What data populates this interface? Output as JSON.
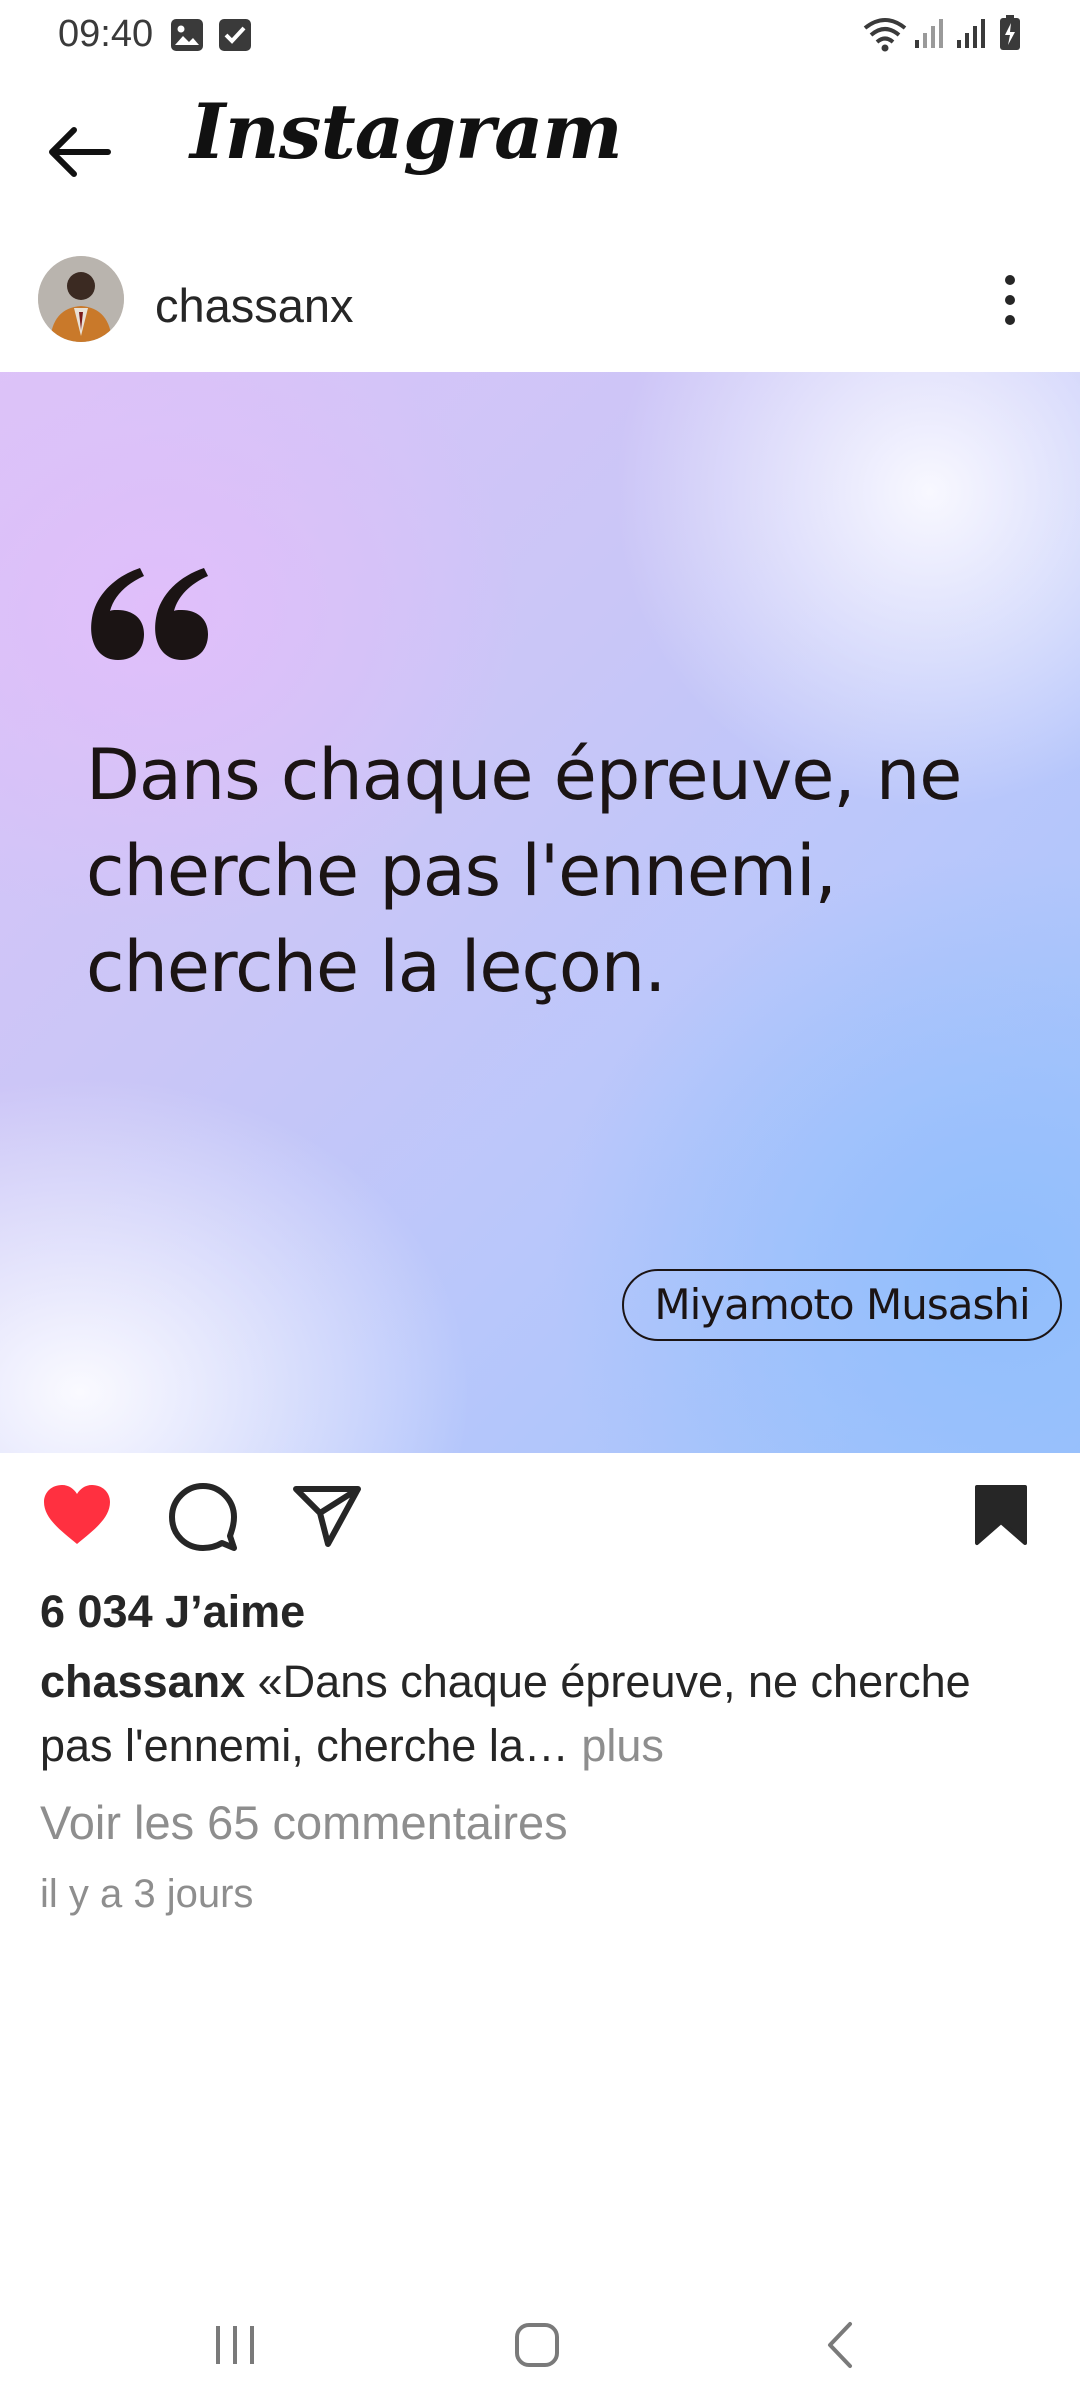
{
  "status_bar": {
    "time": "09:40",
    "left_icons": [
      "image-icon",
      "checkbox-icon"
    ],
    "right_icons": [
      "wifi-icon",
      "signal-icon",
      "signal-icon",
      "battery-icon"
    ]
  },
  "header": {
    "back_icon": "arrow-left-icon",
    "title": "Instagram"
  },
  "post": {
    "username": "chassanx",
    "more_icon": "vertical-dots-icon",
    "quote_text": "Dans chaque épreuve, ne cherche pas l'ennemi, cherche la leçon.",
    "author": "Miyamoto Musashi",
    "liked": true,
    "saved": true,
    "likes_label": "6 034 J’aime",
    "caption_user": "chassanx",
    "caption_text": "«Dans chaque épreuve, ne cherche pas l'ennemi, cherche la",
    "caption_ellipsis": "…",
    "caption_more": " plus",
    "comments_label": "Voir les 65 commentaires",
    "time_ago": "il y a 3 jours"
  },
  "colors": {
    "like_red": "#ff3040",
    "text": "#262626",
    "muted": "#8e8e8e"
  },
  "nav_bar": {
    "icons": [
      "recent-apps-icon",
      "home-icon",
      "back-icon"
    ]
  }
}
